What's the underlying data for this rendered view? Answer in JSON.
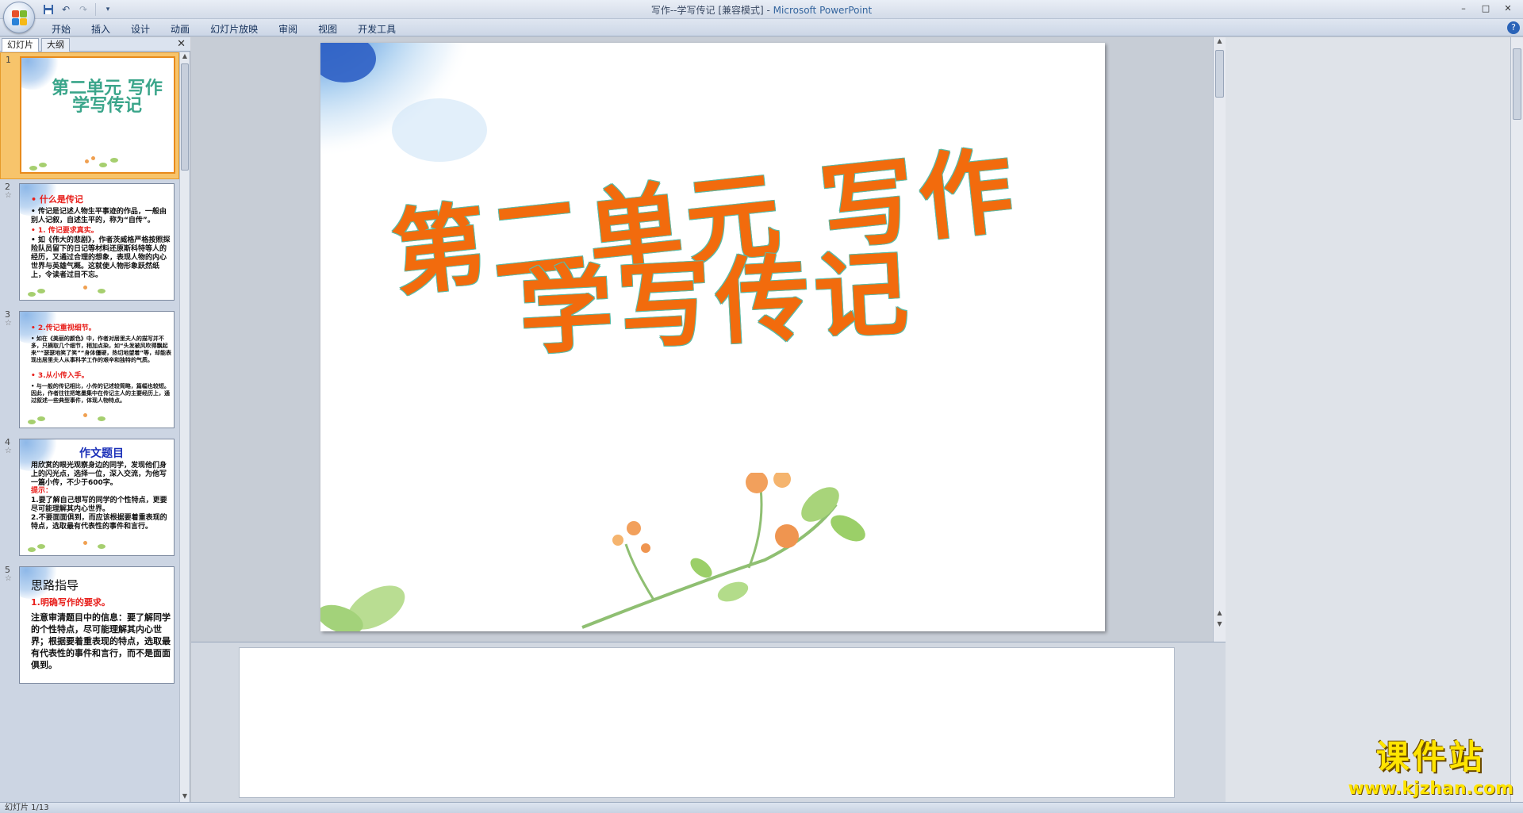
{
  "window": {
    "title": "写作--学写传记 [兼容模式] - ",
    "app": "Microsoft PowerPoint",
    "controls": [
      "–",
      "□",
      "✕"
    ]
  },
  "quick_access": {
    "save_icon": "save-icon",
    "undo_icon": "undo-icon",
    "redo_icon": "redo-icon",
    "customize_icon": "dropdown-icon"
  },
  "ribbon": {
    "tabs": [
      "开始",
      "插入",
      "设计",
      "动画",
      "幻灯片放映",
      "审阅",
      "视图",
      "开发工具"
    ],
    "help": "?"
  },
  "left_pane": {
    "tabs": [
      "幻灯片",
      "大纲"
    ],
    "close": "✕"
  },
  "slides": [
    {
      "num": "1",
      "title_line1": "第二单元 写作",
      "title_line2": "学写传记"
    },
    {
      "num": "2",
      "lines": [
        {
          "text": "• 什么是传记",
          "cls": "red"
        },
        {
          "text": "• 传记是记述人物生平事迹的作品，一般由别人记叙，自述生平的，称为“自传”。",
          "cls": "blk"
        },
        {
          "text": "• 1. 传记要求真实。",
          "cls": "red"
        },
        {
          "text": "• 如《伟大的悲剧》，作者茨威格严格按照探险队员留下的日记等材料还原斯科特等人的经历，又通过合理的想象，表现人物的内心世界与英雄气概。这就使人物形象跃然纸上，令读者过目不忘。",
          "cls": "blk"
        }
      ]
    },
    {
      "num": "3",
      "lines": [
        {
          "text": "• 2.传记重视细节。",
          "cls": "red"
        },
        {
          "text": "• 如在《美丽的颜色》中，作者对居里夫人的描写并不多，只摘取几个细节，稍加点染，如“头发被风吹得飘起来”“瑟瑟地笑了笑”“身体僵硬，热切地望着”等，却能表现出居里夫人从事科学工作的艰辛和独特的气质。",
          "cls": "blk"
        },
        {
          "text": "• 3.从小传入手。",
          "cls": "red"
        },
        {
          "text": "• 与一般的传记相比，小传的记述较简略，篇幅也较短。因此，作者往往把笔墨集中在传记主人的主要经历上，通过叙述一些典型事件，体现人物特点。",
          "cls": "blk"
        }
      ]
    },
    {
      "num": "4",
      "heading": "作文题目",
      "lines": [
        {
          "text": "用欣赏的眼光观察身边的同学，发现他们身上的闪光点，选择一位，深入交流，为他写一篇小传，不少于600字。",
          "cls": "blk"
        },
        {
          "text": "提示：",
          "cls": "red"
        },
        {
          "text": "1.要了解自己想写的同学的个性特点，更要尽可能理解其内心世界。",
          "cls": "blk"
        },
        {
          "text": "2.不要面面俱到，而应该根据要着重表现的特点，选取最有代表性的事件和言行。",
          "cls": "blk"
        }
      ]
    },
    {
      "num": "5",
      "heading": "思路指导",
      "lines": [
        {
          "text": "1.明确写作的要求。",
          "cls": "red"
        },
        {
          "text": "注意审清题目中的信息：要了解同学的个性特点，尽可能理解其内心世界；根据要着重表现的特点，选取最有代表性的事件和言行，而不是面面俱到。",
          "cls": "blk"
        }
      ]
    }
  ],
  "main_slide": {
    "title_line1": "第二单元  写作",
    "title_line2": "学写传记"
  },
  "statusbar": {
    "text": "幻灯片 1/13"
  },
  "watermark": {
    "cn": "课件站",
    "url": "www.kjzhan.com"
  },
  "colors": {
    "title_orange": "#f26b0d",
    "title_outline": "#5bb9a4",
    "thumb_selected": "#f7c46b",
    "watermark": "#ffe400"
  }
}
